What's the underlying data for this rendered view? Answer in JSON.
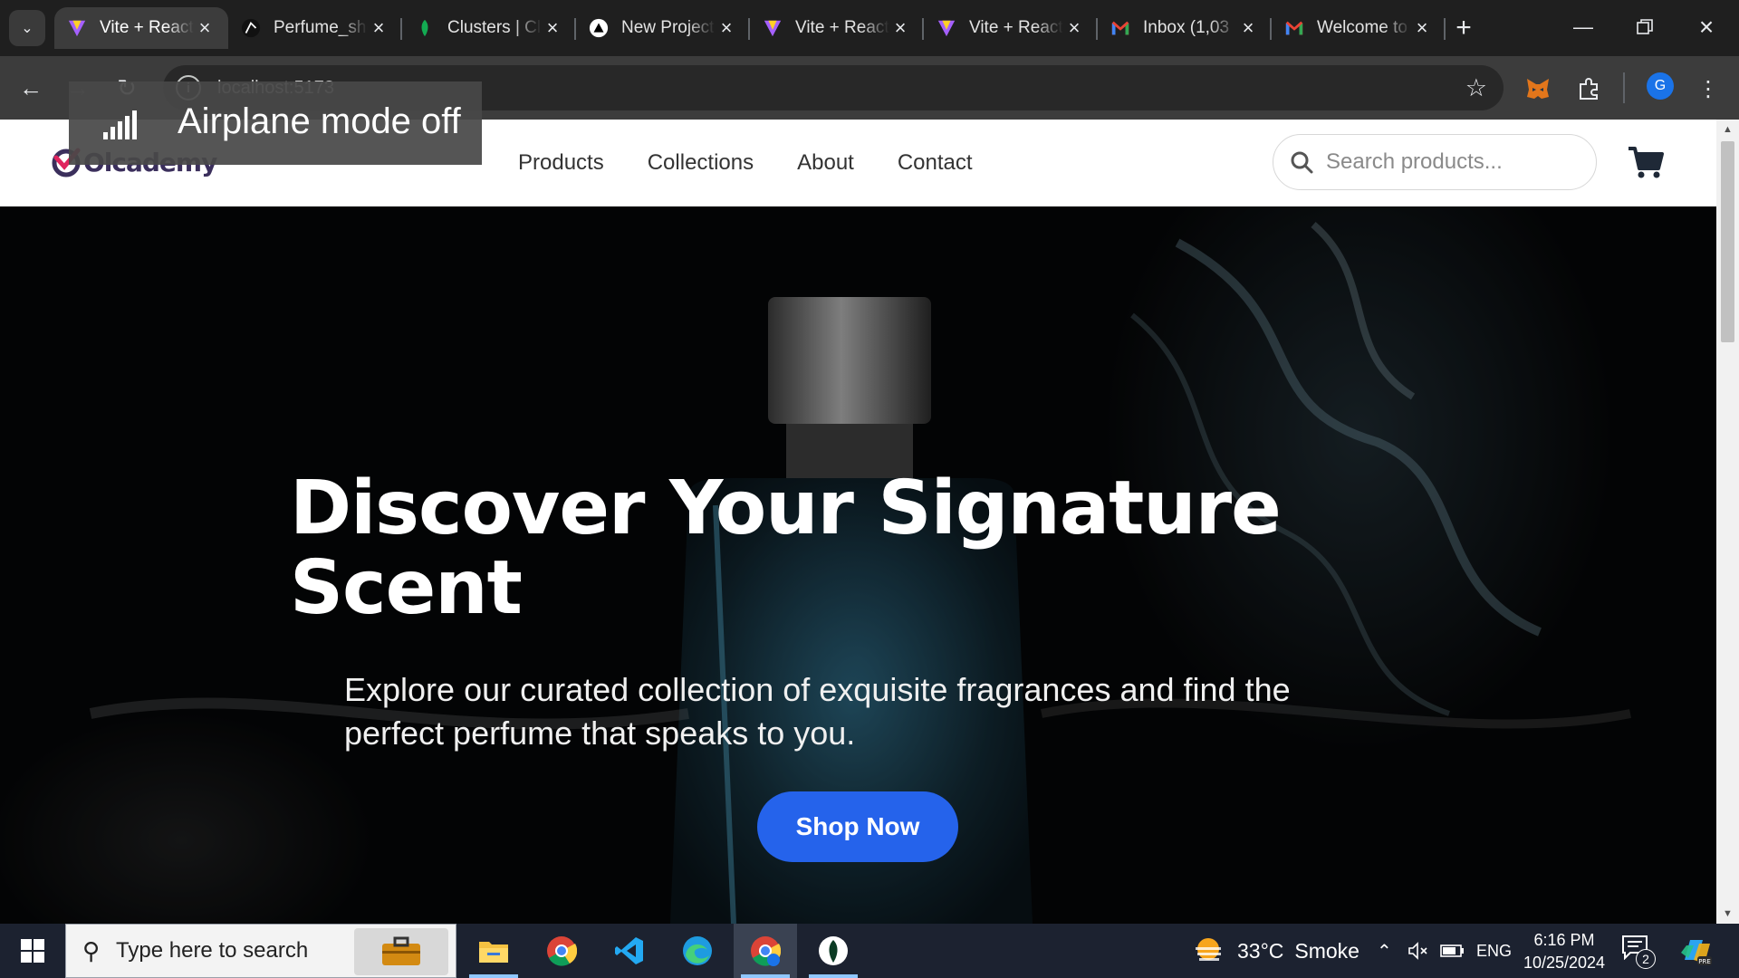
{
  "browser": {
    "tabs": [
      {
        "title": "Vite + React",
        "favicon": "vite-icon",
        "active": true
      },
      {
        "title": "Perfume_shop",
        "favicon": "github-icon",
        "active": false
      },
      {
        "title": "Clusters | Cloud",
        "favicon": "mongodb-leaf-icon",
        "active": false
      },
      {
        "title": "New Project",
        "favicon": "vercel-triangle-icon",
        "active": false
      },
      {
        "title": "Vite + React",
        "favicon": "vite-icon",
        "active": false
      },
      {
        "title": "Vite + React",
        "favicon": "vite-icon",
        "active": false
      },
      {
        "title": "Inbox (1,03",
        "favicon": "gmail-icon",
        "active": false
      },
      {
        "title": "Welcome to",
        "favicon": "gmail-icon",
        "active": false
      }
    ],
    "address": "localhost:5173",
    "profile_initial": "G"
  },
  "toast": {
    "text": "Airplane mode off",
    "icon": "signal-bars-icon"
  },
  "site": {
    "logo_text": "Olcademy",
    "nav": [
      "Products",
      "Collections",
      "About",
      "Contact"
    ],
    "search_placeholder": "Search products...",
    "hero": {
      "title": "Discover Your Signature Scent",
      "subtitle": "Explore our curated collection of exquisite fragrances and find the perfect perfume that speaks to you.",
      "cta": "Shop Now"
    },
    "accent_color": "#2563eb"
  },
  "taskbar": {
    "search_placeholder": "Type here to search",
    "weather": {
      "temp": "33°C",
      "condition": "Smoke"
    },
    "language": "ENG",
    "time": "6:16 PM",
    "date": "10/25/2024",
    "notification_count": "2"
  }
}
